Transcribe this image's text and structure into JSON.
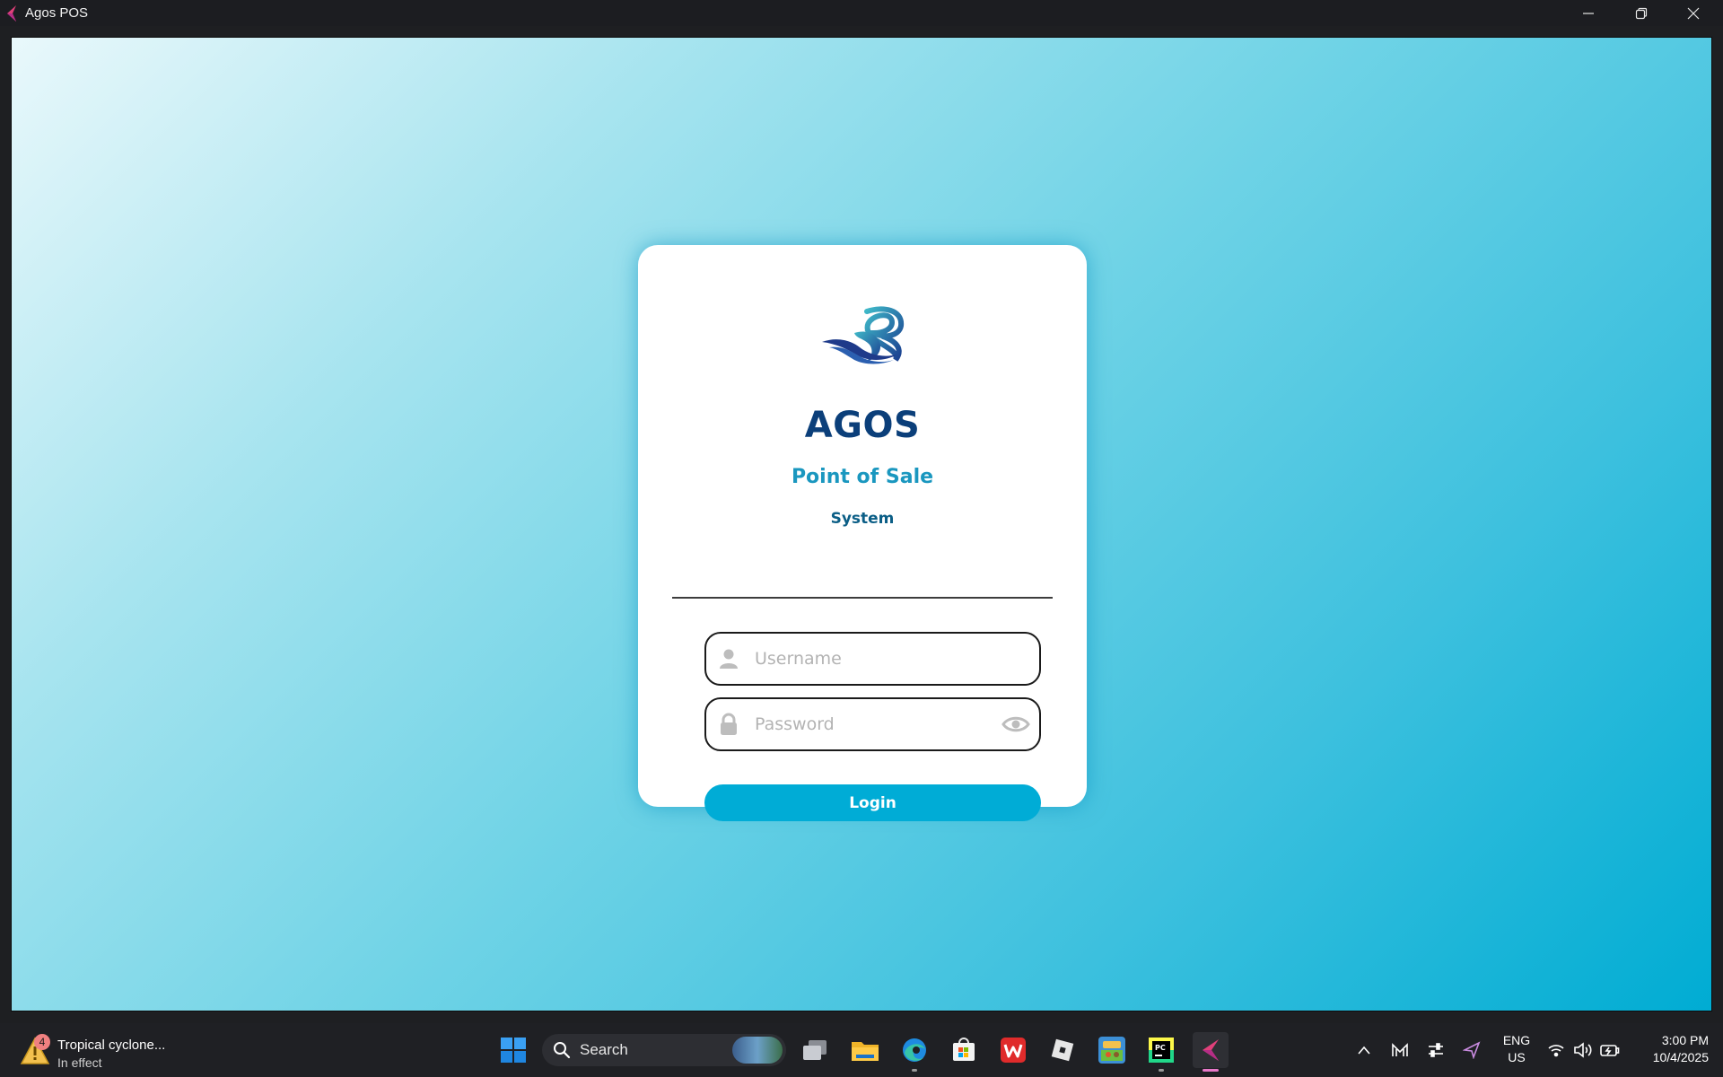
{
  "window": {
    "title": "Agos POS",
    "minimize_icon": "minimize-icon",
    "maximize_icon": "restore-icon",
    "close_icon": "close-icon"
  },
  "login": {
    "logo_icon": "agos-wave-logo",
    "brand": "AGOS",
    "subtitle": "Point of Sale",
    "tagline": "System",
    "username_placeholder": "Username",
    "username_value": "",
    "password_placeholder": "Password",
    "password_value": "",
    "login_label": "Login",
    "colors": {
      "brand": "#0b3f7a",
      "subtitle": "#1a97bf",
      "tagline": "#0b5e86",
      "button": "#00acd6",
      "background_start": "#e9f8fb",
      "background_end": "#00acd3"
    }
  },
  "taskbar": {
    "weather": {
      "badge": "4",
      "title": "Tropical cyclone...",
      "subtitle": "In effect",
      "icon": "warning-icon"
    },
    "search_label": "Search",
    "pinned": [
      {
        "name": "start-button",
        "icon": "windows-icon"
      },
      {
        "name": "task-view",
        "icon": "task-view-icon"
      },
      {
        "name": "file-explorer",
        "icon": "folder-icon"
      },
      {
        "name": "edge",
        "icon": "edge-icon"
      },
      {
        "name": "microsoft-store",
        "icon": "store-icon"
      },
      {
        "name": "wps-office",
        "icon": "wps-icon"
      },
      {
        "name": "roblox",
        "icon": "roblox-icon"
      },
      {
        "name": "game",
        "icon": "game-icon"
      },
      {
        "name": "pycharm",
        "icon": "pycharm-icon"
      },
      {
        "name": "agos-pos",
        "icon": "agos-app-icon"
      }
    ],
    "tray": {
      "language_line1": "ENG",
      "language_line2": "US",
      "time": "3:00 PM",
      "date": "10/4/2025"
    }
  }
}
